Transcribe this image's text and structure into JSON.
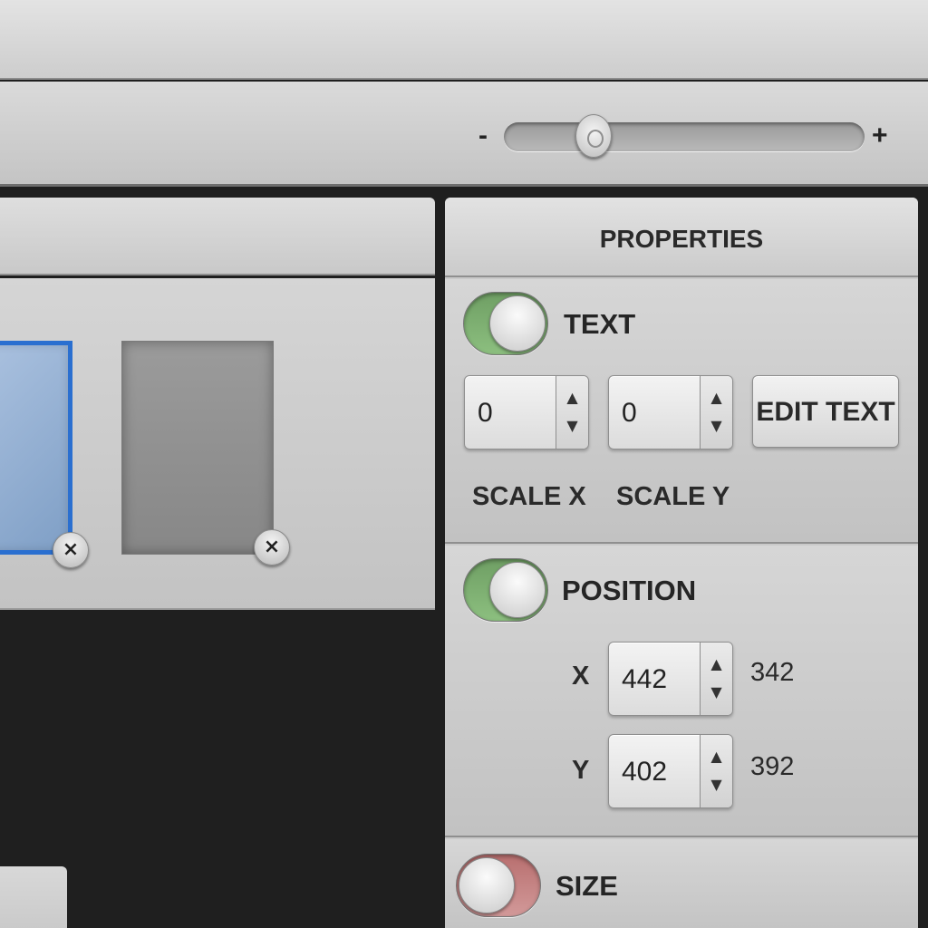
{
  "toolbar": {
    "zoom": {
      "minus_label": "-",
      "plus_label": "+",
      "level": 0.22
    }
  },
  "library": {
    "thumbnails": [
      {
        "state": "selected",
        "delete_icon": "close-x-icon",
        "delete_glyph": "×"
      },
      {
        "state": "normal",
        "delete_icon": "close-x-icon",
        "delete_glyph": "×"
      }
    ]
  },
  "properties": {
    "title": "PROPERTIES",
    "text_section": {
      "label": "TEXT",
      "enabled": true,
      "scale_x": {
        "value": "0",
        "label": "SCALE X"
      },
      "scale_y": {
        "value": "0",
        "label": "SCALE Y"
      },
      "edit_button": "EDIT TEXT"
    },
    "position_section": {
      "label": "POSITION",
      "enabled": true,
      "x": {
        "label": "X",
        "value": "442",
        "current": "342"
      },
      "y": {
        "label": "Y",
        "value": "402",
        "current": "392"
      }
    },
    "size_section": {
      "label": "SIZE",
      "enabled": false
    }
  },
  "stepper_glyphs": {
    "up": "▲",
    "down": "▼"
  },
  "colors": {
    "toggle_on": "#7fb173",
    "toggle_off": "#c98585",
    "selection_border": "#2a6fd0"
  }
}
